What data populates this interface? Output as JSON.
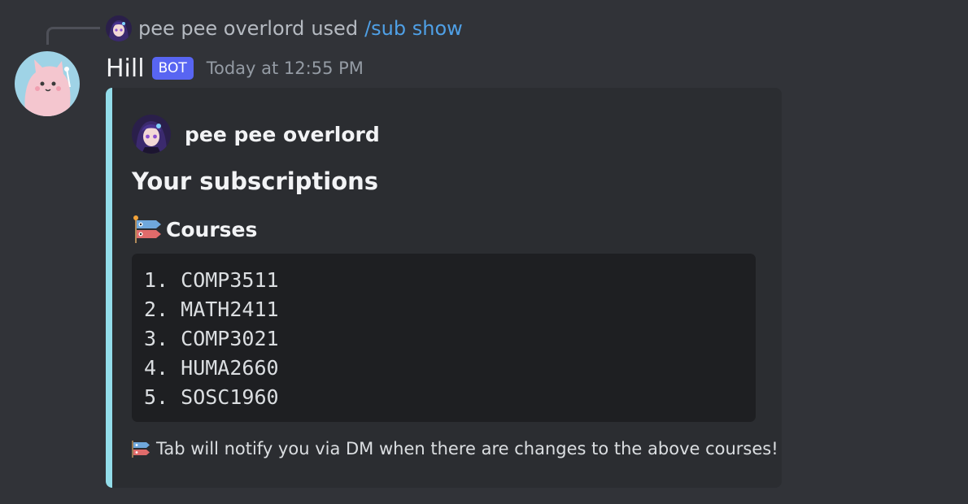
{
  "command": {
    "user_name": "pee pee overlord",
    "used_text": "used",
    "command_name": "/sub show"
  },
  "message": {
    "bot_name": "Hill",
    "bot_tag": "BOT",
    "timestamp": "Today at 12:55 PM"
  },
  "embed": {
    "accent_color": "#93ddea",
    "author_name": "pee pee overlord",
    "title": "Your subscriptions",
    "field_name": "Courses",
    "field_icon": "carp-streamer-icon",
    "courses": [
      "1. COMP3511",
      "2. MATH2411",
      "3. COMP3021",
      "4. HUMA2660",
      "5. SOSC1960"
    ],
    "footer_icon": "carp-streamer-icon",
    "footer_text": "Tab will notify you via DM when there are changes to the above courses!"
  },
  "colors": {
    "background": "#313338",
    "embed_background": "#2b2d31",
    "code_background": "#1e1f22",
    "bot_tag": "#5865f2",
    "command_link": "#4fa0e6"
  }
}
